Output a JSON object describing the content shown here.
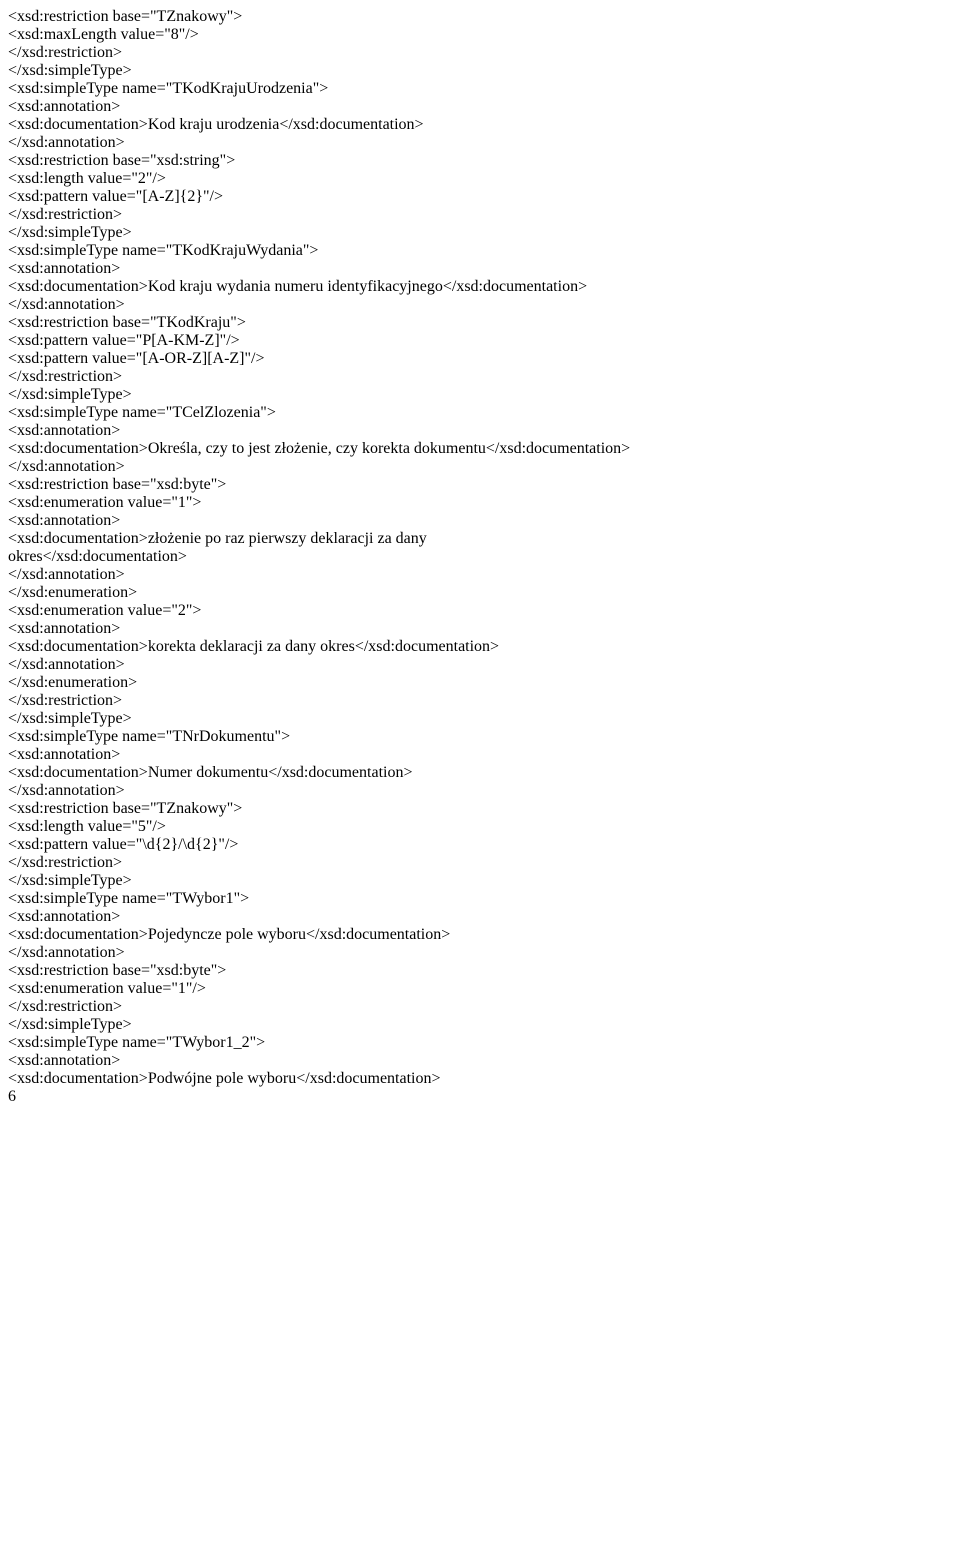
{
  "L": [
    {
      "i": 2,
      "p": [
        [
          "t",
          "<xsd:restriction base="
        ],
        [
          "a",
          "\"TZnakowy\""
        ],
        [
          "t",
          ">"
        ]
      ]
    },
    {
      "i": 3,
      "p": [
        [
          "t",
          "<xsd:maxLength value="
        ],
        [
          "a",
          "\"8\""
        ],
        [
          "t",
          "/>"
        ]
      ]
    },
    {
      "i": 2,
      "p": [
        [
          "t",
          "</xsd:restriction>"
        ]
      ]
    },
    {
      "i": 1,
      "p": [
        [
          "t",
          "</xsd:simpleType>"
        ]
      ]
    },
    {
      "i": 1,
      "p": [
        [
          "t",
          "<xsd:simpleType name="
        ],
        [
          "a",
          "\"TKodKrajuUrodzenia\""
        ],
        [
          "t",
          ">"
        ]
      ]
    },
    {
      "i": 2,
      "p": [
        [
          "t",
          "<xsd:annotation>"
        ]
      ]
    },
    {
      "i": 3,
      "p": [
        [
          "t",
          "<xsd:documentation>"
        ],
        [
          "x",
          "Kod kraju urodzenia"
        ],
        [
          "t",
          "</xsd:documentation>"
        ]
      ]
    },
    {
      "i": 2,
      "p": [
        [
          "t",
          "</xsd:annotation>"
        ]
      ]
    },
    {
      "i": 2,
      "p": [
        [
          "t",
          "<xsd:restriction base="
        ],
        [
          "a",
          "\"xsd:string\""
        ],
        [
          "t",
          ">"
        ]
      ]
    },
    {
      "i": 3,
      "p": [
        [
          "t",
          "<xsd:length value="
        ],
        [
          "a",
          "\"2\""
        ],
        [
          "t",
          "/>"
        ]
      ]
    },
    {
      "i": 3,
      "p": [
        [
          "t",
          "<xsd:pattern value="
        ],
        [
          "a",
          "\"[A-Z]{2}\""
        ],
        [
          "t",
          "/>"
        ]
      ]
    },
    {
      "i": 2,
      "p": [
        [
          "t",
          "</xsd:restriction>"
        ]
      ]
    },
    {
      "i": 1,
      "p": [
        [
          "t",
          "</xsd:simpleType>"
        ]
      ]
    },
    {
      "i": 1,
      "p": [
        [
          "t",
          "<xsd:simpleType name="
        ],
        [
          "a",
          "\"TKodKrajuWydania\""
        ],
        [
          "t",
          ">"
        ]
      ]
    },
    {
      "i": 2,
      "p": [
        [
          "t",
          "<xsd:annotation>"
        ]
      ]
    },
    {
      "i": 3,
      "p": [
        [
          "t",
          "<xsd:documentation>"
        ],
        [
          "x",
          "Kod kraju wydania numeru identyfikacyjnego"
        ],
        [
          "t",
          "</xsd:documentation>"
        ]
      ]
    },
    {
      "i": 2,
      "p": [
        [
          "t",
          "</xsd:annotation>"
        ]
      ]
    },
    {
      "i": 2,
      "p": [
        [
          "t",
          "<xsd:restriction base="
        ],
        [
          "a",
          "\"TKodKraju\""
        ],
        [
          "t",
          ">"
        ]
      ]
    },
    {
      "i": 3,
      "p": [
        [
          "t",
          "<xsd:pattern value="
        ],
        [
          "a",
          "\"P[A-KM-Z]\""
        ],
        [
          "t",
          "/>"
        ]
      ]
    },
    {
      "i": 3,
      "p": [
        [
          "t",
          "<xsd:pattern value="
        ],
        [
          "a",
          "\"[A-OR-Z][A-Z]\""
        ],
        [
          "t",
          "/>"
        ]
      ]
    },
    {
      "i": 2,
      "p": [
        [
          "t",
          "</xsd:restriction>"
        ]
      ]
    },
    {
      "i": 1,
      "p": [
        [
          "t",
          "</xsd:simpleType>"
        ]
      ]
    },
    {
      "i": 1,
      "p": [
        [
          "t",
          "<xsd:simpleType name="
        ],
        [
          "a",
          "\"TCelZlozenia\""
        ],
        [
          "t",
          ">"
        ]
      ]
    },
    {
      "i": 2,
      "p": [
        [
          "t",
          "<xsd:annotation>"
        ]
      ]
    },
    {
      "i": 3,
      "p": [
        [
          "t",
          "<xsd:documentation>"
        ],
        [
          "x",
          "Określa, czy to jest złożenie, czy korekta dokumentu"
        ],
        [
          "t",
          "</xsd:documentation>"
        ]
      ]
    },
    {
      "i": 2,
      "p": [
        [
          "t",
          "</xsd:annotation>"
        ]
      ]
    },
    {
      "i": 2,
      "p": [
        [
          "t",
          "<xsd:restriction base="
        ],
        [
          "a",
          "\"xsd:byte\""
        ],
        [
          "t",
          ">"
        ]
      ]
    },
    {
      "i": 3,
      "p": [
        [
          "t",
          "<xsd:enumeration value="
        ],
        [
          "a",
          "\"1\""
        ],
        [
          "t",
          ">"
        ]
      ]
    },
    {
      "i": 4,
      "p": [
        [
          "t",
          "<xsd:annotation>"
        ]
      ]
    },
    {
      "i": 5,
      "p": [
        [
          "t",
          "<xsd:documentation>"
        ],
        [
          "x",
          "złożenie po raz pierwszy deklaracji za dany"
        ]
      ]
    },
    {
      "i": 0,
      "p": [
        [
          "x",
          "okres"
        ],
        [
          "t",
          "</xsd:documentation>"
        ]
      ]
    },
    {
      "i": 4,
      "p": [
        [
          "t",
          "</xsd:annotation>"
        ]
      ]
    },
    {
      "i": 3,
      "p": [
        [
          "t",
          "</xsd:enumeration>"
        ]
      ]
    },
    {
      "i": 3,
      "p": [
        [
          "t",
          "<xsd:enumeration value="
        ],
        [
          "a",
          "\"2\""
        ],
        [
          "t",
          ">"
        ]
      ]
    },
    {
      "i": 4,
      "p": [
        [
          "t",
          "<xsd:annotation>"
        ]
      ]
    },
    {
      "i": 5,
      "p": [
        [
          "t",
          "<xsd:documentation>"
        ],
        [
          "x",
          "korekta deklaracji za dany okres"
        ],
        [
          "t",
          "</xsd:documentation>"
        ]
      ]
    },
    {
      "i": 4,
      "p": [
        [
          "t",
          "</xsd:annotation>"
        ]
      ]
    },
    {
      "i": 3,
      "p": [
        [
          "t",
          "</xsd:enumeration>"
        ]
      ]
    },
    {
      "i": 2,
      "p": [
        [
          "t",
          "</xsd:restriction>"
        ]
      ]
    },
    {
      "i": 1,
      "p": [
        [
          "t",
          "</xsd:simpleType>"
        ]
      ]
    },
    {
      "i": 1,
      "p": [
        [
          "t",
          "<xsd:simpleType name="
        ],
        [
          "a",
          "\"TNrDokumentu\""
        ],
        [
          "t",
          ">"
        ]
      ]
    },
    {
      "i": 2,
      "p": [
        [
          "t",
          "<xsd:annotation>"
        ]
      ]
    },
    {
      "i": 3,
      "p": [
        [
          "t",
          "<xsd:documentation>"
        ],
        [
          "x",
          "Numer dokumentu"
        ],
        [
          "t",
          "</xsd:documentation>"
        ]
      ]
    },
    {
      "i": 2,
      "p": [
        [
          "t",
          "</xsd:annotation>"
        ]
      ]
    },
    {
      "i": 2,
      "p": [
        [
          "t",
          "<xsd:restriction base="
        ],
        [
          "a",
          "\"TZnakowy\""
        ],
        [
          "t",
          ">"
        ]
      ]
    },
    {
      "i": 3,
      "p": [
        [
          "t",
          "<xsd:length value="
        ],
        [
          "a",
          "\"5\""
        ],
        [
          "t",
          "/>"
        ]
      ]
    },
    {
      "i": 3,
      "p": [
        [
          "t",
          "<xsd:pattern value="
        ],
        [
          "a",
          "\"\\d{2}/\\d{2}\""
        ],
        [
          "t",
          "/>"
        ]
      ]
    },
    {
      "i": 2,
      "p": [
        [
          "t",
          "</xsd:restriction>"
        ]
      ]
    },
    {
      "i": 1,
      "p": [
        [
          "t",
          "</xsd:simpleType>"
        ]
      ]
    },
    {
      "i": 1,
      "p": [
        [
          "t",
          "<xsd:simpleType name="
        ],
        [
          "a",
          "\"TWybor1\""
        ],
        [
          "t",
          ">"
        ]
      ]
    },
    {
      "i": 2,
      "p": [
        [
          "t",
          "<xsd:annotation>"
        ]
      ]
    },
    {
      "i": 3,
      "p": [
        [
          "t",
          "<xsd:documentation>"
        ],
        [
          "x",
          "Pojedyncze pole wyboru"
        ],
        [
          "t",
          "</xsd:documentation>"
        ]
      ]
    },
    {
      "i": 2,
      "p": [
        [
          "t",
          "</xsd:annotation>"
        ]
      ]
    },
    {
      "i": 2,
      "p": [
        [
          "t",
          "<xsd:restriction base="
        ],
        [
          "a",
          "\"xsd:byte\""
        ],
        [
          "t",
          ">"
        ]
      ]
    },
    {
      "i": 3,
      "p": [
        [
          "t",
          "<xsd:enumeration value="
        ],
        [
          "a",
          "\"1\""
        ],
        [
          "t",
          "/>"
        ]
      ]
    },
    {
      "i": 2,
      "p": [
        [
          "t",
          "</xsd:restriction>"
        ]
      ]
    },
    {
      "i": 1,
      "p": [
        [
          "t",
          "</xsd:simpleType>"
        ]
      ]
    },
    {
      "i": 1,
      "p": [
        [
          "t",
          "<xsd:simpleType name="
        ],
        [
          "a",
          "\"TWybor1_2\""
        ],
        [
          "t",
          ">"
        ]
      ]
    },
    {
      "i": 2,
      "p": [
        [
          "t",
          "<xsd:annotation>"
        ]
      ]
    },
    {
      "i": 3,
      "p": [
        [
          "t",
          "<xsd:documentation>"
        ],
        [
          "x",
          "Podwójne pole wyboru"
        ],
        [
          "t",
          "</xsd:documentation>"
        ]
      ]
    }
  ],
  "PAGE": "6"
}
